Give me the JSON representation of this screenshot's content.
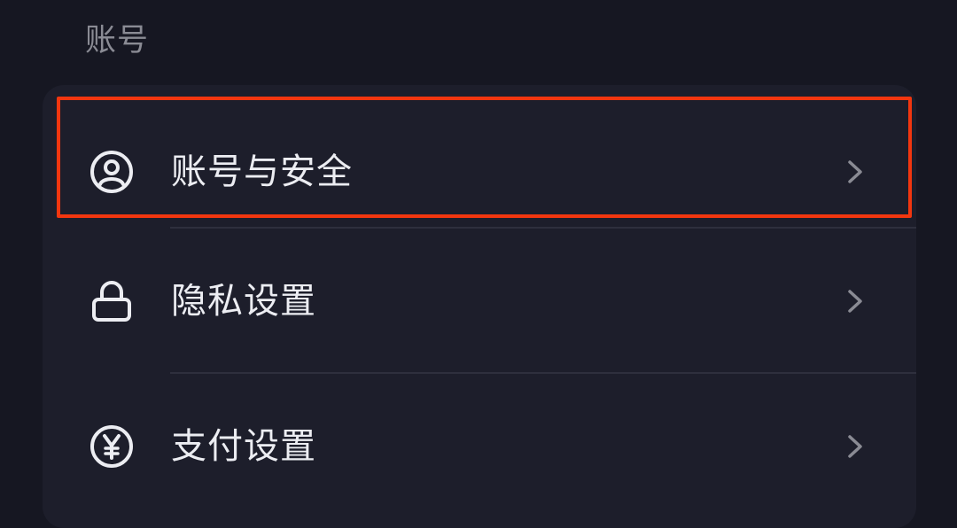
{
  "section": {
    "title": "账号"
  },
  "menu": {
    "items": [
      {
        "label": "账号与安全",
        "icon": "user-circle-icon"
      },
      {
        "label": "隐私设置",
        "icon": "lock-icon"
      },
      {
        "label": "支付设置",
        "icon": "yen-circle-icon"
      }
    ]
  },
  "colors": {
    "background": "#161722",
    "card": "#1d1e2b",
    "text_primary": "#ecedf2",
    "text_secondary": "#8a8b94",
    "highlight": "#f2360f"
  }
}
